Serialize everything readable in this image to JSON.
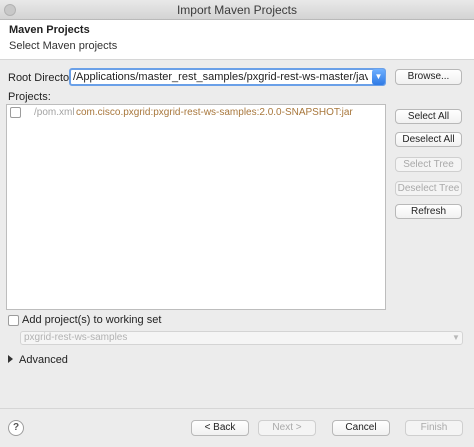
{
  "window": {
    "title": "Import Maven Projects"
  },
  "header": {
    "title": "Maven Projects",
    "subtitle": "Select Maven projects"
  },
  "root": {
    "label": "Root Directory:",
    "value": "/Applications/master_rest_samples/pxgrid-rest-ws-master/java",
    "browse": "Browse..."
  },
  "projects": {
    "label": "Projects:",
    "items": [
      {
        "pom": "/pom.xml",
        "artifact": "com.cisco.pxgrid:pxgrid-rest-ws-samples:2.0.0-SNAPSHOT:jar",
        "checked": false
      }
    ]
  },
  "side_buttons": {
    "select_all": "Select All",
    "deselect_all": "Deselect All",
    "select_tree": "Select Tree",
    "deselect_tree": "Deselect Tree",
    "refresh": "Refresh"
  },
  "working_set": {
    "label": "Add project(s) to working set",
    "value": "pxgrid-rest-ws-samples"
  },
  "advanced": {
    "label": "Advanced"
  },
  "footer": {
    "back": "< Back",
    "next": "Next >",
    "cancel": "Cancel",
    "finish": "Finish",
    "help_icon": "?"
  },
  "colors": {
    "accent": "#2f7ae5",
    "artifact": "#a8773c"
  }
}
